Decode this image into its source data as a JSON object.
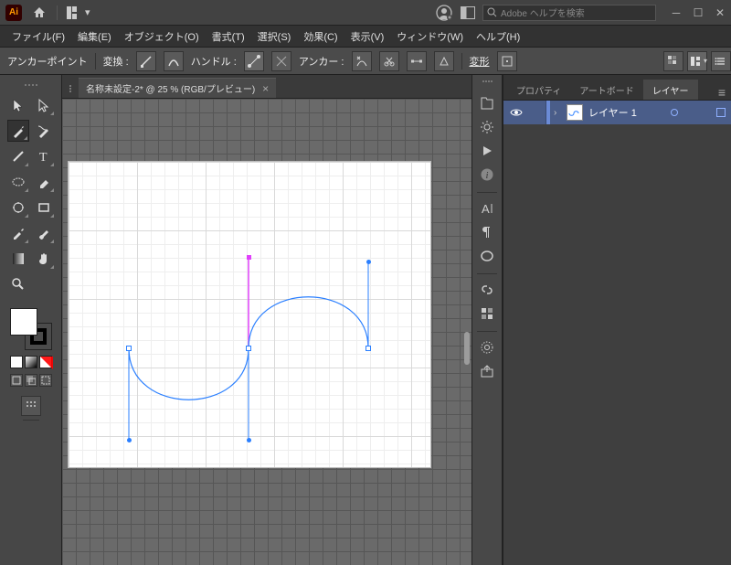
{
  "titlebar": {
    "app_abbrev": "Ai",
    "search_placeholder": "Adobe ヘルプを検索"
  },
  "menubar": {
    "file": "ファイル(F)",
    "edit": "編集(E)",
    "object": "オブジェクト(O)",
    "type": "書式(T)",
    "select": "選択(S)",
    "effect": "効果(C)",
    "view": "表示(V)",
    "window": "ウィンドウ(W)",
    "help": "ヘルプ(H)"
  },
  "control": {
    "mode_label": "アンカーポイント",
    "convert_label": "変換 :",
    "handle_label": "ハンドル :",
    "anchor_label": "アンカー :",
    "transform_label": "変形"
  },
  "doc": {
    "tab_title": "名称未設定-2* @ 25 % (RGB/プレビュー)"
  },
  "panels": {
    "properties": "プロパティ",
    "artboards": "アートボード",
    "layers": "レイヤー",
    "layer1_name": "レイヤー 1"
  },
  "icons": {
    "home": "home-icon",
    "workspace": "workspace-switcher-icon",
    "account": "account-icon",
    "screen_mode": "screen-mode-icon",
    "search": "search-icon",
    "minimize": "minimize-icon",
    "maximize": "maximize-icon",
    "close_window": "close-window-icon",
    "close_tab": "close-tab-icon",
    "panel_menu": "panel-menu-icon"
  }
}
